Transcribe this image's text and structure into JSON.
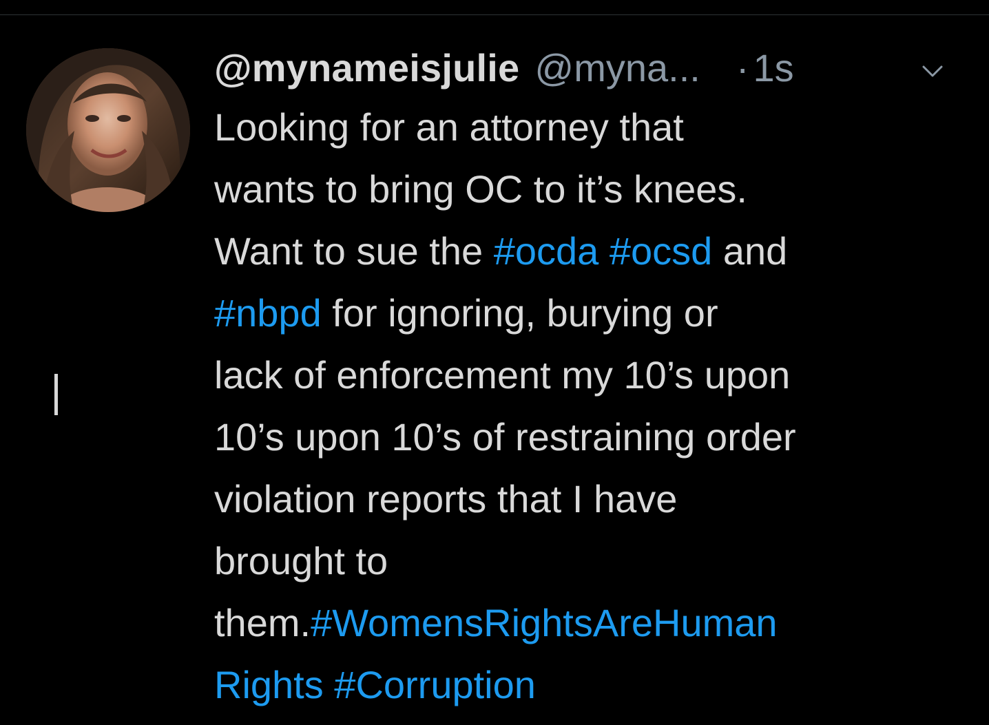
{
  "tweet": {
    "display_name": "@mynameisjulie",
    "handle": "@myna...",
    "dot": "·",
    "time": "1s",
    "caret_icon": "chevron-down-icon",
    "lines": [
      [
        {
          "text": "Looking for an attorney that",
          "type": "text"
        }
      ],
      [
        {
          "text": "wants to bring OC to it’s knees.",
          "type": "text"
        }
      ],
      [
        {
          "text": "Want to sue the ",
          "type": "text"
        },
        {
          "text": "#ocda",
          "type": "hashtag"
        },
        {
          "text": " ",
          "type": "text"
        },
        {
          "text": "#ocsd",
          "type": "hashtag"
        },
        {
          "text": " and",
          "type": "text"
        }
      ],
      [
        {
          "text": "#nbpd",
          "type": "hashtag"
        },
        {
          "text": " for ignoring, burying or",
          "type": "text"
        }
      ],
      [
        {
          "text": "lack of enforcement my 10’s upon",
          "type": "text"
        }
      ],
      [
        {
          "text": "10’s upon 10’s of restraining order",
          "type": "text"
        }
      ],
      [
        {
          "text": "violation reports that I have",
          "type": "text"
        }
      ],
      [
        {
          "text": "brought to",
          "type": "text"
        }
      ],
      [
        {
          "text": "them.",
          "type": "text"
        },
        {
          "text": "#WomensRightsAreHuman",
          "type": "hashtag"
        }
      ],
      [
        {
          "text": "Rights",
          "type": "hashtag"
        },
        {
          "text": " ",
          "type": "text"
        },
        {
          "text": "#Corruption",
          "type": "hashtag"
        }
      ]
    ]
  },
  "colors": {
    "background": "#000000",
    "text": "#d9d9d9",
    "muted": "#8b98a5",
    "hashtag": "#1d9bf0"
  }
}
